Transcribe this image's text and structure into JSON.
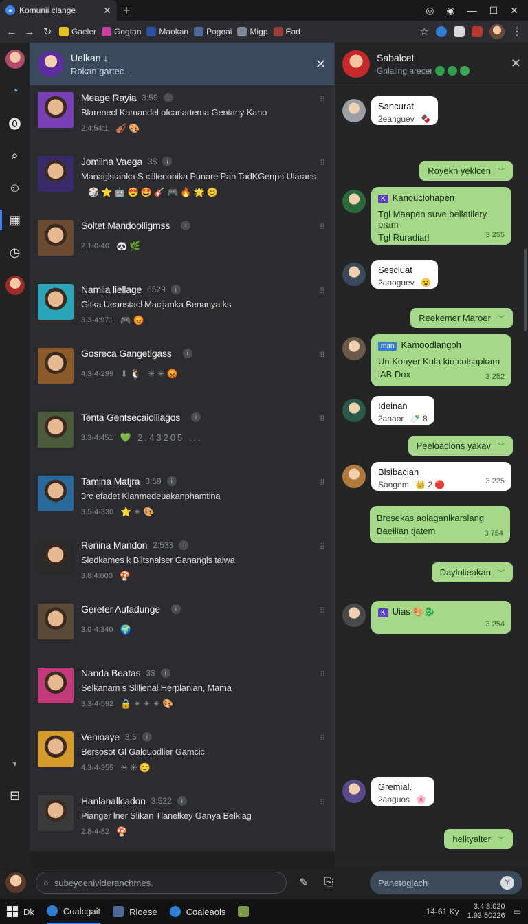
{
  "browser": {
    "tab_title": "Komunii clange",
    "bookmarks": [
      "Gaeler",
      "Gogtan",
      "Maokan",
      "Pogoai",
      "Migp",
      "Ead"
    ]
  },
  "left_rail": {
    "items": [
      "profile",
      "chat",
      "status",
      "search",
      "people",
      "grid",
      "timer",
      "contact"
    ]
  },
  "list_header": {
    "name": "Uelkan ↓",
    "subtitle": "Rokan gartec -"
  },
  "chats": [
    {
      "name": "Meage Rayia",
      "time": "3:59",
      "msg": "Blarenecl Kamandel ofcarlartema Gentany Kano",
      "meta": "2.4:54:1",
      "emoji": "🎻🎨",
      "avatar": "#7b3fb5"
    },
    {
      "name": "Jomiina Vaega",
      "time": "3$",
      "msg": "Managlstanka S cilllenooika Punare Pan TadKGenpa Ularans",
      "meta": "",
      "emoji": "🎲⭐🤖😍🤩🎸🎮🔥🌟😊",
      "avatar": "#3a2a6a"
    },
    {
      "name": "Soltet Mandoolligmss",
      "time": "",
      "msg": "",
      "meta": "2.1-0-40",
      "emoji": "🐼🌿",
      "avatar": "#6b4a32"
    },
    {
      "name": "Namlia liellage",
      "time": "6529",
      "msg": "Gitka Ueanstacl Macljanka Benanya ks",
      "meta": "3.3-4:971",
      "emoji": "🎮😡",
      "avatar": "#2aa6b8"
    },
    {
      "name": "Gosreca Gangetlgass",
      "time": "",
      "msg": "",
      "meta": "4.3-4-299",
      "emoji": "⬇🐧 ✳✳😡",
      "avatar": "#8a5a2a"
    },
    {
      "name": "Tenta Gentsecaiolliagos",
      "time": "",
      "msg": "",
      "meta": "3.3-4:451",
      "emoji": "💚 2.43205 ...",
      "avatar": "#4a5a3a"
    },
    {
      "name": "Tamina Matjra",
      "time": "3:59",
      "msg": "3rc efadet Kianmedeuakanphamtina",
      "meta": "3.5-4-330",
      "emoji": "⭐✴🎨",
      "avatar": "#2a6a9a"
    },
    {
      "name": "Renina Mandon",
      "time": "2:533",
      "msg": "Sledkames k Blltsnalser Ganangls talwa",
      "meta": "3.8:4:600",
      "emoji": "🍄",
      "avatar": "#2a2a2a"
    },
    {
      "name": "Gereter Aufadunge",
      "time": "",
      "msg": "",
      "meta": "3.0-4:340",
      "emoji": "🌍",
      "avatar": "#5a4a3a"
    },
    {
      "name": "Nanda Beatas",
      "time": "3$",
      "msg": "Selkanam s Slllienal Herplanlan, Mama",
      "meta": "3.3-4-592",
      "emoji": "🔒✴✴✴🎨",
      "avatar": "#c23a7a"
    },
    {
      "name": "Venioaye",
      "time": "3:5",
      "msg": "Bersosot Gl Galduodlier Gamcic",
      "meta": "4.3-4-355",
      "emoji": "✳✳😊",
      "avatar": "#d49a2a"
    },
    {
      "name": "Hanlanallcadon",
      "time": "3:522",
      "msg": "Pianger lner Slikan Tlanelkey Ganya Belklag",
      "meta": "2.8-4-82",
      "emoji": "🍄",
      "avatar": "#3a3a3a"
    }
  ],
  "conversation": {
    "name": "Sabalcet",
    "subtitle": "Gnlaling arecer",
    "messages": [
      {
        "dir": "in",
        "title": "Sancurat",
        "sub": "2eanguev",
        "emoji": "🍫"
      },
      {
        "dir": "out",
        "text": "Royekn yeklcen"
      },
      {
        "dir": "in-green",
        "title": "Kanouclohapen",
        "line1": "Tgl Maapen suve bellatilery pram",
        "line2": "Tgl Ruradiarl",
        "time": "3 255"
      },
      {
        "dir": "in",
        "title": "Sescluat",
        "sub": "2anoguev",
        "emoji": "😮"
      },
      {
        "dir": "out",
        "text": "Reekemer Maroer"
      },
      {
        "dir": "in-green",
        "title": "Kamoodlangoh",
        "tag": "man",
        "line1": "Un Konyer Kula kio colsapkam",
        "line2": "lAB Dox",
        "time": "3 252"
      },
      {
        "dir": "in",
        "title": "Ideinan",
        "sub": "2anaor",
        "emoji": "🍼 8"
      },
      {
        "dir": "out",
        "text": "Peeloaclons yakav"
      },
      {
        "dir": "in",
        "title": "Blsibacian",
        "sub": "Sangem",
        "emoji": "👑 2 🔴",
        "time": "3 225"
      },
      {
        "dir": "in-plain",
        "line1": "Bresekas aolaganlkarslang",
        "line2": "Baeilian tjatem",
        "time": "3 754"
      },
      {
        "dir": "out",
        "text": "Daylolieakan"
      },
      {
        "dir": "in-green",
        "title": "Uias",
        "emoji": "🎨🐉",
        "time": "3 254"
      },
      {
        "dir": "in",
        "title": "Gremial.",
        "sub": "2anguos",
        "emoji": "🌸"
      },
      {
        "dir": "out",
        "text": "helkyalter"
      }
    ]
  },
  "bottom": {
    "search_placeholder": "subeyoenivlderanchmes.",
    "compose_placeholder": "Panetogjach"
  },
  "taskbar": {
    "items": [
      "Dk",
      "Coalcgait",
      "Rloese",
      "Coaleaols"
    ],
    "time": "14-61 Ky",
    "clock_line1": "3.4 8:020",
    "clock_line2": "1.93:50226"
  }
}
